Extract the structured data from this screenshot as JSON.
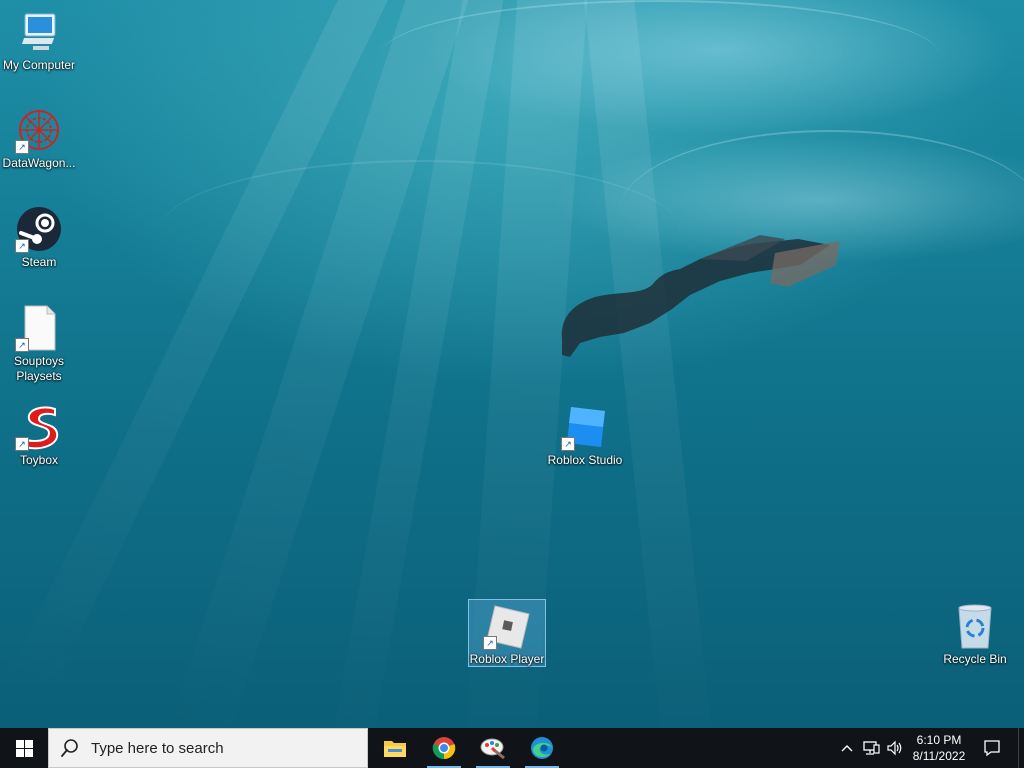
{
  "desktop": {
    "icons": [
      {
        "label": "My Computer",
        "icon": "computer-icon"
      },
      {
        "label": "DataWagon...",
        "icon": "datawagon-icon"
      },
      {
        "label": "Steam",
        "icon": "steam-icon"
      },
      {
        "label": "Souptoys Playsets",
        "icon": "document-icon"
      },
      {
        "label": "Toybox",
        "icon": "toybox-icon"
      },
      {
        "label": "Roblox Studio",
        "icon": "roblox-studio-icon"
      },
      {
        "label": "Roblox Player",
        "icon": "roblox-player-icon"
      },
      {
        "label": "Recycle Bin",
        "icon": "recycle-bin-icon"
      }
    ]
  },
  "taskbar": {
    "search": {
      "placeholder": "Type here to search"
    },
    "pinned_apps": [
      {
        "name": "File Explorer",
        "icon": "folder-icon"
      },
      {
        "name": "Google Chrome",
        "icon": "chrome-icon"
      },
      {
        "name": "Paint",
        "icon": "paint-icon"
      },
      {
        "name": "Microsoft Edge",
        "icon": "edge-icon"
      }
    ],
    "tray": {
      "time": "6:10 PM",
      "date": "8/11/2022"
    }
  },
  "colors": {
    "taskbar": "#101418",
    "accent": "#76b9ed",
    "water": "#157f97"
  }
}
